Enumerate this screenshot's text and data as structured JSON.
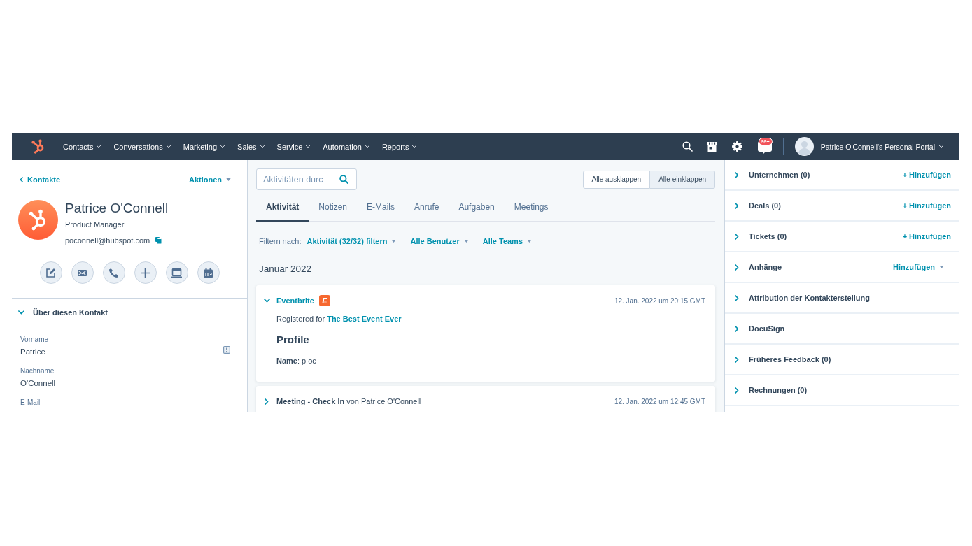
{
  "nav": {
    "menu": [
      {
        "label": "Contacts"
      },
      {
        "label": "Conversations"
      },
      {
        "label": "Marketing"
      },
      {
        "label": "Sales"
      },
      {
        "label": "Service"
      },
      {
        "label": "Automation"
      },
      {
        "label": "Reports"
      }
    ],
    "notifications_badge": "99+",
    "account": "Patrice O'Connell's Personal Portal"
  },
  "contact": {
    "back_link": "Kontakte",
    "actions_menu": "Aktionen",
    "name": "Patrice O'Connell",
    "job_title": "Product Manager",
    "email": "poconnell@hubspot.com"
  },
  "about": {
    "title": "Über diesen Kontakt",
    "expanded": true,
    "properties": [
      {
        "label": "Vorname",
        "value": "Patrice",
        "info_icon": true
      },
      {
        "label": "Nachname",
        "value": "O'Connell",
        "info_icon": false
      },
      {
        "label": "E-Mail",
        "info_icon": false
      }
    ]
  },
  "activity": {
    "search": {
      "placeholder": "Aktivitäten durc"
    },
    "toggle_buttons": [
      {
        "label": "Alle ausklappen",
        "selected": false
      },
      {
        "label": "Alle einklappen",
        "selected": true
      }
    ],
    "tabs": [
      {
        "label": "Aktivität",
        "selected": true
      },
      {
        "label": "Notizen",
        "selected": false
      },
      {
        "label": "E-Mails",
        "selected": false
      },
      {
        "label": "Anrufe",
        "selected": false
      },
      {
        "label": "Aufgaben",
        "selected": false
      },
      {
        "label": "Meetings",
        "selected": false
      }
    ],
    "filter": {
      "label": "Filtern nach:",
      "dropdowns": [
        "Aktivität (32/32) filtern",
        "Alle Benutzer",
        "Alle Teams"
      ]
    },
    "month": "Januar 2022",
    "items": [
      {
        "kind": "app_event",
        "expanded": true,
        "title": "Eventbrite",
        "badge": "E",
        "time": "12. Jan. 2022 um 20:15 GMT",
        "registration": {
          "text": "Registered for",
          "link": "The Best Event Ever"
        },
        "heading": "Profile",
        "detail": "**Name**: p oc"
      },
      {
        "kind": "meeting",
        "expanded": false,
        "title": "**Meeting - Check In** von Patrice O'Connell",
        "time": "12. Jan. 2022 um 12:45 GMT"
      }
    ]
  },
  "sidebar_cards": [
    {
      "title": "Unternehmen (0)",
      "expanded": false,
      "action": {
        "kind": "link",
        "label": "+ Hinzufügen"
      }
    },
    {
      "title": "Deals (0)",
      "expanded": false,
      "action": {
        "kind": "link",
        "label": "+ Hinzufügen"
      }
    },
    {
      "title": "Tickets (0)",
      "expanded": false,
      "action": {
        "kind": "link",
        "label": "+ Hinzufügen"
      }
    },
    {
      "title": "Anhänge",
      "expanded": false,
      "action": {
        "kind": "dropdown",
        "label": "Hinzufügen"
      }
    },
    {
      "title": "Attribution der Kontakterstellung",
      "expanded": false
    },
    {
      "title": "DocuSign",
      "expanded": false
    },
    {
      "title": "Früheres Feedback (0)",
      "expanded": false
    },
    {
      "title": "Rechnungen (0)",
      "expanded": false
    }
  ]
}
